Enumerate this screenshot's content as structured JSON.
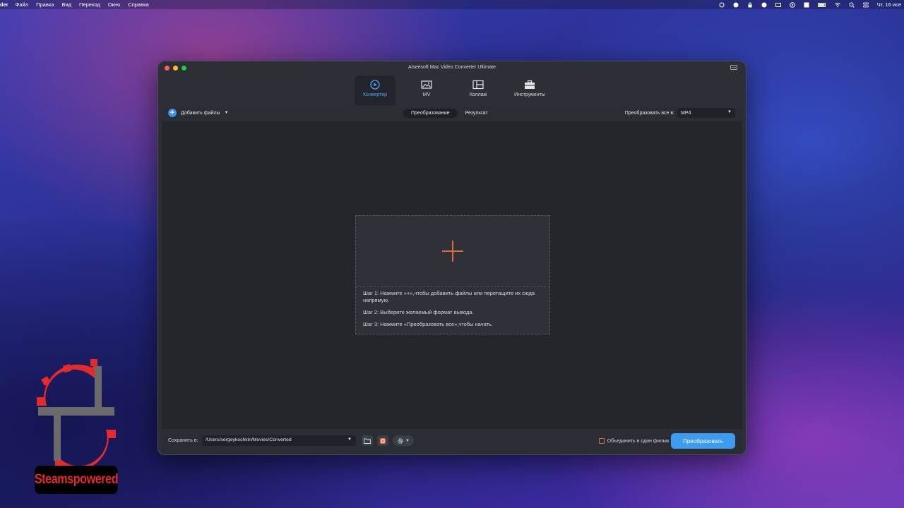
{
  "menubar": {
    "app_name": "der",
    "items": [
      "Файл",
      "Правка",
      "Вид",
      "Переход",
      "Окно",
      "Справка"
    ],
    "clock": "Чт, 16 исе"
  },
  "window": {
    "title": "Aiseesoft Mac Video Converter Ultimate"
  },
  "tabs": [
    {
      "label": "Конвертер",
      "icon": "converter-icon",
      "active": true
    },
    {
      "label": "MV",
      "icon": "mv-icon",
      "active": false
    },
    {
      "label": "Коллаж",
      "icon": "collage-icon",
      "active": false
    },
    {
      "label": "Инструменты",
      "icon": "toolbox-icon",
      "active": false
    }
  ],
  "toolbar": {
    "add_files": "Добавить файлы",
    "segments": [
      "Преобразование",
      "Результат"
    ],
    "convert_all_label": "Преобразовать все в:",
    "format_value": "MP4"
  },
  "drop_zone": {
    "step1": "Шаг 1: Нажмите «+»,чтобы добавить файлы или перетащите их сюда напрямую.",
    "step2": "Шаг 2: Выберите желаемый формат вывода.",
    "step3": "Шаг 3: Нажмите «Преобразовать все»,чтобы начать."
  },
  "bottom": {
    "save_to_label": "Сохранить в:",
    "save_path": "/Users/sergeykochkin/Movies/Converted",
    "merge_label": "Объединить в один фильм",
    "merge_checked": false,
    "convert_button": "Преобразовать"
  },
  "watermark": {
    "text": "Steamspowered"
  },
  "colors": {
    "accent": "#3e9cf0",
    "orange": "#e26b3b",
    "watermark_red": "#e52a2a"
  }
}
